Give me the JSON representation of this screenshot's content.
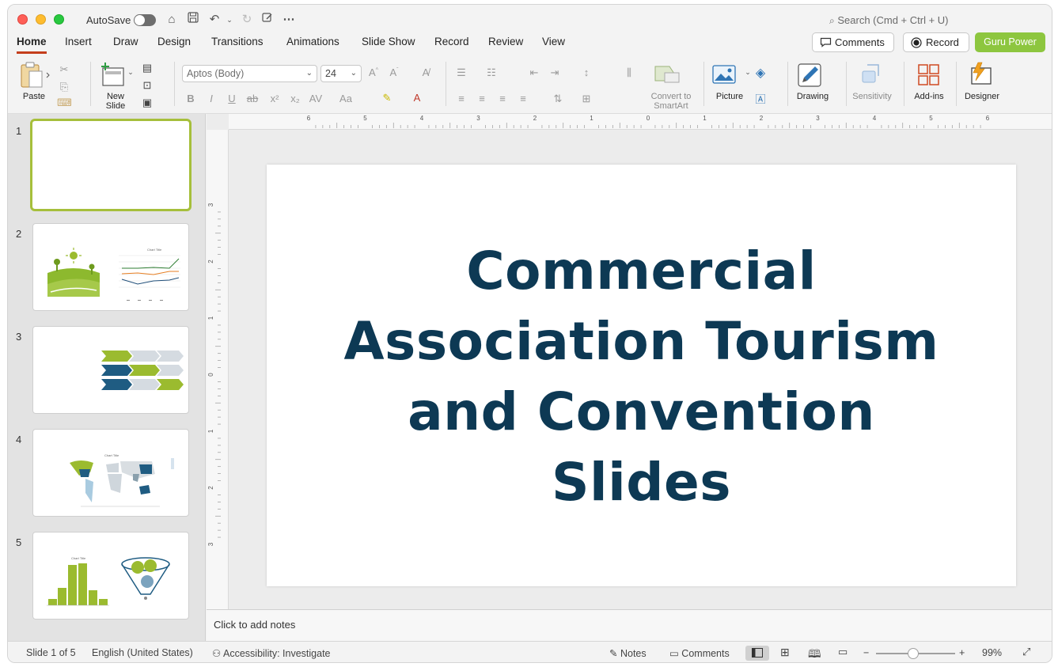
{
  "titlebar": {
    "autosave_label": "AutoSave",
    "search_placeholder": "Search (Cmd + Ctrl + U)"
  },
  "tabs": [
    "Home",
    "Insert",
    "Draw",
    "Design",
    "Transitions",
    "Animations",
    "Slide Show",
    "Record",
    "Review",
    "View"
  ],
  "active_tab": "Home",
  "header_buttons": {
    "comments": "Comments",
    "record": "Record",
    "guru": "Guru Power"
  },
  "ribbon": {
    "paste": "Paste",
    "new_slide_line1": "New",
    "new_slide_line2": "Slide",
    "font_name": "Aptos (Body)",
    "font_size": "24",
    "convert_line1": "Convert to",
    "convert_line2": "SmartArt",
    "picture": "Picture",
    "drawing": "Drawing",
    "sensitivity": "Sensitivity",
    "addins": "Add-ins",
    "designer": "Designer"
  },
  "ruler": {
    "h_labels": [
      "6",
      "5",
      "4",
      "3",
      "2",
      "1",
      "0",
      "1",
      "2",
      "3",
      "4",
      "5",
      "6"
    ],
    "v_labels": [
      "3",
      "2",
      "1",
      "0",
      "1",
      "2",
      "3"
    ]
  },
  "slides": {
    "numbers": [
      "1",
      "2",
      "3",
      "4",
      "5"
    ],
    "thumb2_chart_title": "Chart Title",
    "thumb4_chart_title": "Chart Title",
    "thumb5_chart_title": "Chart Title"
  },
  "main_slide": {
    "title": "Commercial Association Tourism and Convention Slides"
  },
  "notes_placeholder": "Click to add notes",
  "status": {
    "slide_of": "Slide 1 of 5",
    "language": "English (United States)",
    "accessibility": "Accessibility: Investigate",
    "notes": "Notes",
    "comments": "Comments",
    "zoom": "99%"
  },
  "colors": {
    "accent_green": "#8dc63f",
    "title_navy": "#0d3954",
    "record_red": "#c43e1c"
  }
}
